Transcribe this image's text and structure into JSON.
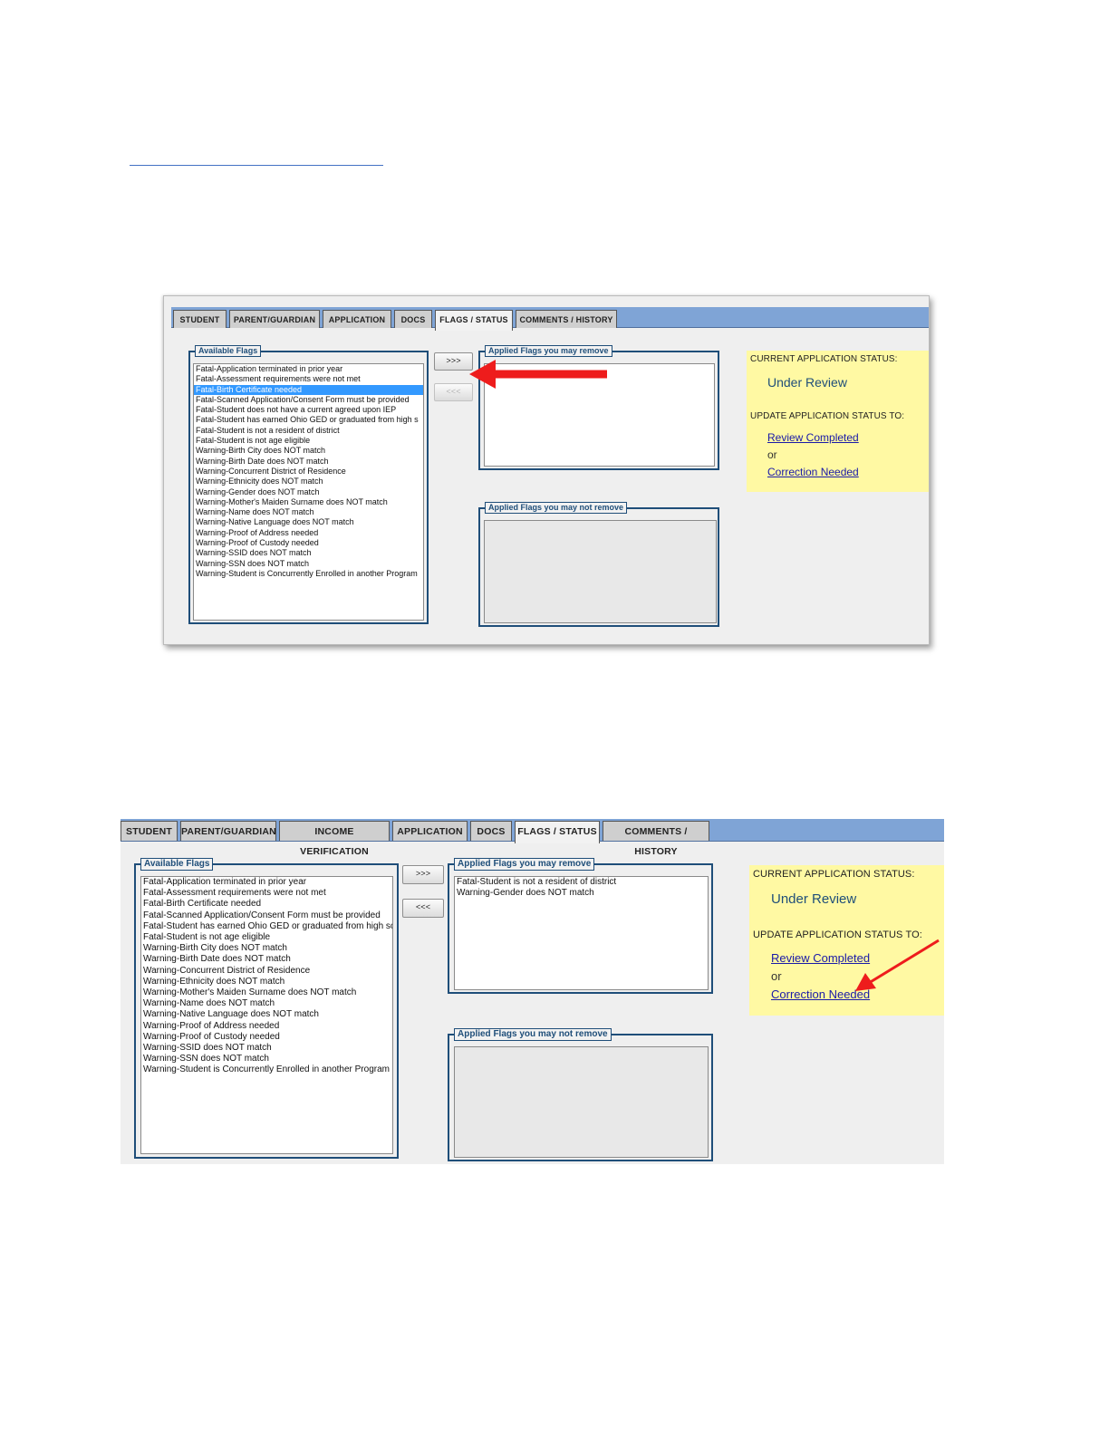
{
  "screenshot1": {
    "tabs": [
      "STUDENT",
      "PARENT/GUARDIAN",
      "APPLICATION",
      "DOCS",
      "FLAGS / STATUS",
      "COMMENTS / HISTORY"
    ],
    "active_tab": "FLAGS / STATUS",
    "available_flags_legend": "Available Flags",
    "available_flags": [
      "Fatal-Application terminated in prior year",
      "Fatal-Assessment requirements were not met",
      "Fatal-Birth Certificate needed",
      "Fatal-Scanned Application/Consent Form must be provided",
      "Fatal-Student does not have a current agreed upon IEP",
      "Fatal-Student has earned Ohio GED or graduated from high s",
      "Fatal-Student is not a resident of district",
      "Fatal-Student is not age eligible",
      "Warning-Birth City does NOT match",
      "Warning-Birth Date does NOT match",
      "Warning-Concurrent District of Residence",
      "Warning-Ethnicity does NOT match",
      "Warning-Gender does NOT match",
      "Warning-Mother's Maiden Surname does NOT match",
      "Warning-Name does NOT match",
      "Warning-Native Language does NOT match",
      "Warning-Proof of Address needed",
      "Warning-Proof of Custody needed",
      "Warning-SSID does NOT match",
      "Warning-SSN does NOT match",
      "Warning-Student is Concurrently Enrolled in another Program"
    ],
    "selected_flag": "Fatal-Birth Certificate needed",
    "add_button": ">>>",
    "remove_button": "<<<",
    "removable_legend": "Applied Flags you may remove",
    "removable_flags": [],
    "non_removable_legend": "Applied Flags you may not remove",
    "non_removable_flags": [],
    "current_status_label": "CURRENT APPLICATION STATUS:",
    "current_status": "Under Review",
    "update_status_label": "UPDATE APPLICATION STATUS TO:",
    "review_completed_link": "Review Completed",
    "or_text": "or",
    "correction_needed_link": "Correction Needed",
    "annotation_color": "#ee1c1c"
  },
  "screenshot2": {
    "tabs": [
      "STUDENT",
      "PARENT/GUARDIAN",
      "INCOME VERIFICATION",
      "APPLICATION",
      "DOCS",
      "FLAGS / STATUS",
      "COMMENTS / HISTORY"
    ],
    "active_tab": "FLAGS / STATUS",
    "available_flags_legend": "Available Flags",
    "available_flags": [
      "Fatal-Application terminated in prior year",
      "Fatal-Assessment requirements were not met",
      "Fatal-Birth Certificate needed",
      "Fatal-Scanned Application/Consent Form must be provided",
      "Fatal-Student has earned Ohio GED or graduated from high sc",
      "Fatal-Student is not age eligible",
      "Warning-Birth City does NOT match",
      "Warning-Birth Date does NOT match",
      "Warning-Concurrent District of Residence",
      "Warning-Ethnicity does NOT match",
      "Warning-Mother's Maiden Surname does NOT match",
      "Warning-Name does NOT match",
      "Warning-Native Language does NOT match",
      "Warning-Proof of Address needed",
      "Warning-Proof of Custody needed",
      "Warning-SSID does NOT match",
      "Warning-SSN does NOT match",
      "Warning-Student is Concurrently Enrolled in another Program"
    ],
    "add_button": ">>>",
    "remove_button": "<<<",
    "removable_legend": "Applied Flags you may remove",
    "removable_flags": [
      "Fatal-Student is not a resident of district",
      "Warning-Gender does NOT match"
    ],
    "non_removable_legend": "Applied Flags you may not remove",
    "non_removable_flags": [],
    "current_status_label": "CURRENT APPLICATION STATUS:",
    "current_status": "Under Review",
    "update_status_label": "UPDATE APPLICATION STATUS TO:",
    "review_completed_link": "Review Completed",
    "or_text": "or",
    "correction_needed_link": "Correction Needed",
    "annotation_color": "#ee1c1c"
  }
}
